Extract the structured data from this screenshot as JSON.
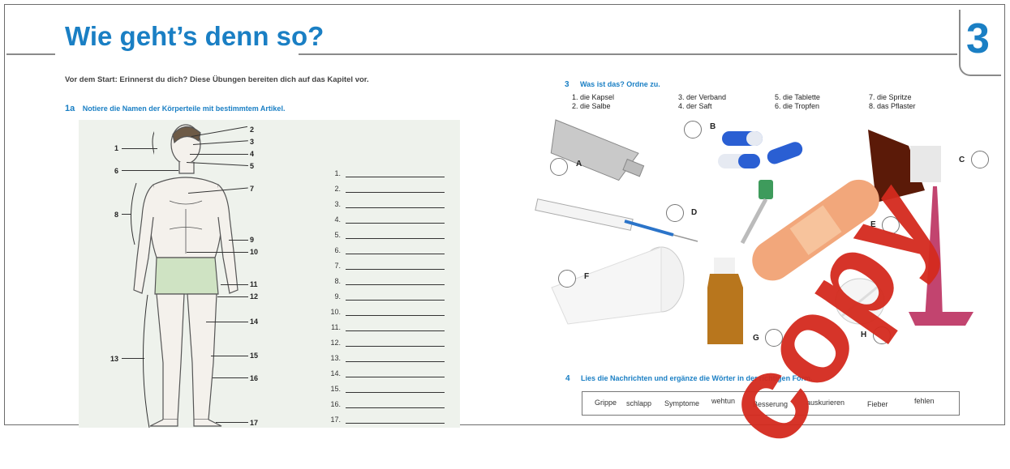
{
  "page": {
    "title": "Wie geht’s denn so?",
    "chapter_number": "3",
    "intro": "Vor dem Start: Erinnerst du dich? Diese Übungen bereiten dich auf das Kapitel vor.",
    "watermark": "copy"
  },
  "ex1": {
    "number": "1a",
    "instruction": "Notiere die Namen der Körperteile mit bestimmtem Artikel.",
    "figure_labels": [
      "1",
      "2",
      "3",
      "4",
      "5",
      "6",
      "7",
      "8",
      "9",
      "10",
      "11",
      "12",
      "13",
      "14",
      "15",
      "16",
      "17"
    ],
    "answer_numbers": [
      "1.",
      "2.",
      "3.",
      "4.",
      "5.",
      "6.",
      "7.",
      "8.",
      "9.",
      "10.",
      "11.",
      "12.",
      "13.",
      "14.",
      "15.",
      "16.",
      "17."
    ]
  },
  "ex3": {
    "number": "3",
    "instruction": "Was ist das? Ordne zu.",
    "options": [
      [
        "1. die Kapsel",
        "2. die Salbe"
      ],
      [
        "3. der Verband",
        "4. der Saft"
      ],
      [
        "5. die Tablette",
        "6. die Tropfen"
      ],
      [
        "7. die Spritze",
        "8. das Pflaster"
      ]
    ],
    "photo_letters": [
      "A",
      "B",
      "C",
      "D",
      "E",
      "F",
      "G",
      "H"
    ]
  },
  "ex4": {
    "number": "4",
    "instruction": "Lies die Nachrichten und ergänze die Wörter in der richtigen Form.",
    "words": [
      "Grippe",
      "schlapp",
      "Symptome",
      "wehtun",
      "Besserung",
      "auskurieren",
      "Fieber",
      "fehlen"
    ]
  }
}
